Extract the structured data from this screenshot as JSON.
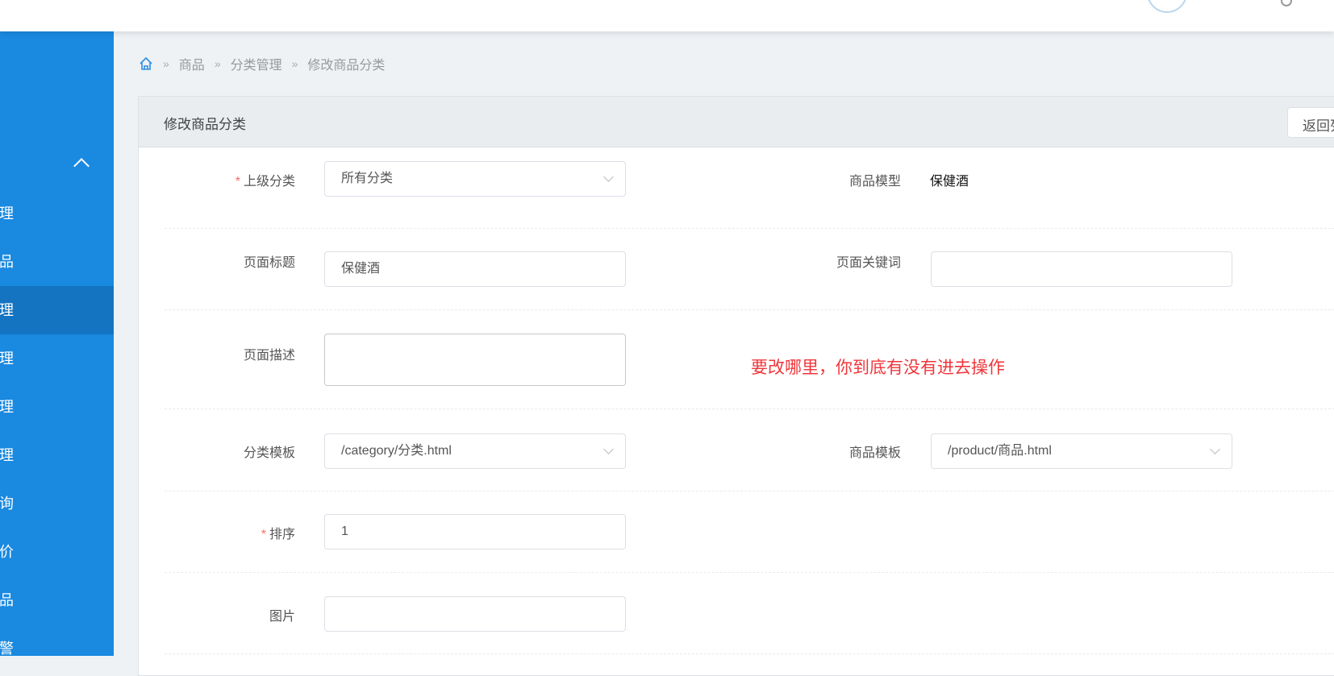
{
  "sidebar": {
    "items": [
      "理",
      "品",
      "理",
      "理",
      "理",
      "理",
      "询",
      "价",
      "品",
      "警"
    ],
    "active_index": 2
  },
  "breadcrumb": {
    "items": [
      "商品",
      "分类管理",
      "修改商品分类"
    ],
    "separator": "»"
  },
  "panel": {
    "title": "修改商品分类",
    "back_button": "返回列表"
  },
  "form": {
    "parent_category": {
      "label": "上级分类",
      "value": "所有分类"
    },
    "product_model": {
      "label": "商品模型",
      "value": "保健酒"
    },
    "page_title": {
      "label": "页面标题",
      "value": "保健酒"
    },
    "page_keywords": {
      "label": "页面关键词",
      "value": ""
    },
    "page_description": {
      "label": "页面描述",
      "value": ""
    },
    "category_template": {
      "label": "分类模板",
      "value": "/category/分类.html"
    },
    "product_template": {
      "label": "商品模板",
      "value": "/product/商品.html"
    },
    "sort": {
      "label": "排序",
      "value": "1"
    },
    "image": {
      "label": "图片",
      "value": ""
    },
    "required_mark": "*"
  },
  "annotation": "要改哪里，你到底有没有进去操作",
  "colors": {
    "sidebar": "#1a89e0",
    "sidebar_active": "#1474c2",
    "annotation": "#f0363b"
  }
}
